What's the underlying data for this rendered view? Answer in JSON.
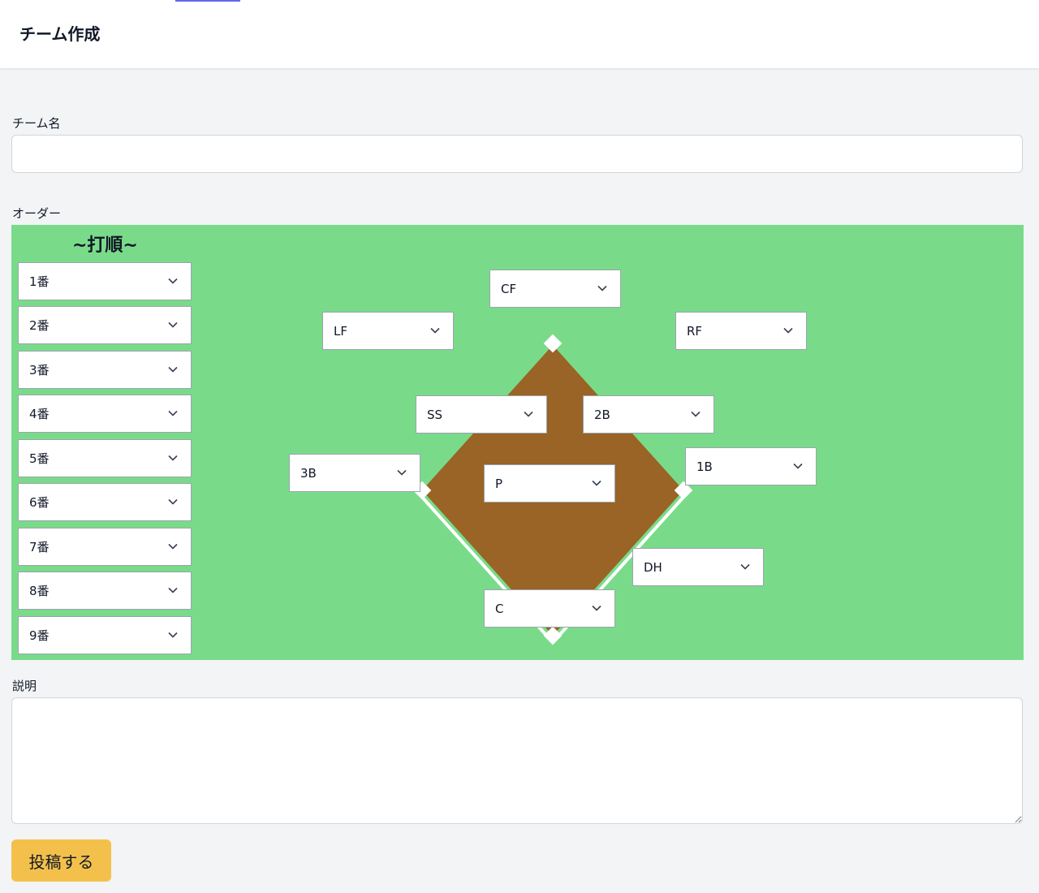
{
  "header": {
    "title": "チーム作成"
  },
  "form": {
    "team_name_label": "チーム名",
    "team_name_value": "",
    "order_label": "オーダー",
    "batting_order_title": "~打順~",
    "batting_slots": [
      "1番",
      "2番",
      "3番",
      "4番",
      "5番",
      "6番",
      "7番",
      "8番",
      "9番"
    ],
    "positions": {
      "cf": "CF",
      "lf": "LF",
      "rf": "RF",
      "ss": "SS",
      "second": "2B",
      "third": "3B",
      "pitcher": "P",
      "first": "1B",
      "dh": "DH",
      "catcher": "C"
    },
    "description_label": "説明",
    "description_value": "",
    "submit_label": "投稿する"
  },
  "colors": {
    "field_grass": "#79db89",
    "infield_dirt": "#996425",
    "submit_button": "#f3c14b",
    "base": "#ffffff"
  },
  "icons": {
    "select_arrow": "chevron-down-icon"
  }
}
